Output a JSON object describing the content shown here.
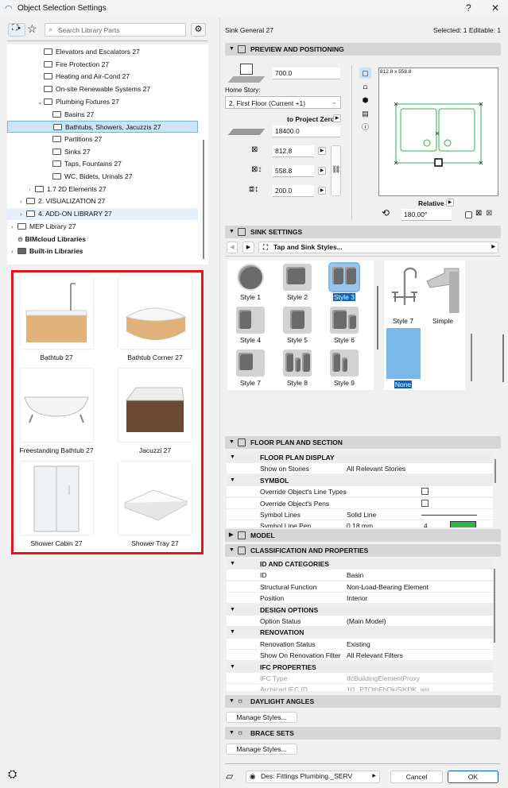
{
  "window": {
    "title": "Object Selection Settings",
    "help": "?",
    "close": "✕"
  },
  "library": {
    "search_placeholder": "Search Library Parts",
    "tree": [
      {
        "label": "Elevators and Escalators 27",
        "indent": 3
      },
      {
        "label": "Fire Protection 27",
        "indent": 3
      },
      {
        "label": "Heating and Air-Cond 27",
        "indent": 3
      },
      {
        "label": "On-site Renewable Systems 27",
        "indent": 3
      },
      {
        "label": "Plumbing Fixtures 27",
        "indent": 3,
        "expanded": true
      },
      {
        "label": "Basins 27",
        "indent": 4
      },
      {
        "label": "Bathtubs, Showers, Jacuzzis 27",
        "indent": 4,
        "selected": true
      },
      {
        "label": "Partitions 27",
        "indent": 4
      },
      {
        "label": "Sinks 27",
        "indent": 4
      },
      {
        "label": "Taps, Fountains 27",
        "indent": 4
      },
      {
        "label": "WC, Bidets, Urinals 27",
        "indent": 4
      },
      {
        "label": "1.7 2D Elements 27",
        "indent": 2,
        "collapsed": true
      },
      {
        "label": "2. VISUALIZATION 27",
        "indent": 1,
        "collapsed": true
      },
      {
        "label": "4. ADD-ON LIBRARY 27",
        "indent": 1,
        "collapsed": true,
        "highlight": true
      },
      {
        "label": "MEP Library 27",
        "indent": 0,
        "collapsed": true
      },
      {
        "label": "BIMcloud Libraries",
        "indent": 0,
        "bold": true,
        "cloud": true
      },
      {
        "label": "Built-in Libraries",
        "indent": 0,
        "bold": true,
        "collapsed": true,
        "dark": true
      }
    ],
    "items": [
      {
        "label": "Bathtub 27",
        "kind": "bathtub"
      },
      {
        "label": "Bathtub Corner 27",
        "kind": "corner"
      },
      {
        "label": "Freestanding Bathtub 27",
        "kind": "freestanding"
      },
      {
        "label": "Jacuzzi 27",
        "kind": "jacuzzi"
      },
      {
        "label": "Shower Cabin 27",
        "kind": "cabin"
      },
      {
        "label": "Shower Tray 27",
        "kind": "tray"
      }
    ]
  },
  "right": {
    "object_name": "Sink General 27",
    "selection_info": "Selected: 1 Editable: 1",
    "preview": {
      "title": "PREVIEW AND POSITIONING",
      "elevation": "700.0",
      "home_story_label": "Home Story:",
      "home_story": "2. First Floor (Current +1)",
      "to_project_zero": "to Project Zero",
      "project_zero_value": "18400.0",
      "width": "812.8",
      "depth": "558.8",
      "height": "200.0",
      "dimensions_caption": "812.8 x 558.8",
      "relative_label": "Relative",
      "angle": "180.00°"
    },
    "sink": {
      "title": "SINK SETTINGS",
      "dropdown": "Tap and Sink Styles...",
      "styles": [
        {
          "label": "Style 1"
        },
        {
          "label": "Style 2"
        },
        {
          "label": "Style 3",
          "selected": true
        },
        {
          "label": "Style 4"
        },
        {
          "label": "Style 5"
        },
        {
          "label": "Style 6"
        },
        {
          "label": "Style 7"
        },
        {
          "label": "Style 8"
        },
        {
          "label": "Style 9"
        }
      ],
      "taps": [
        {
          "label": "Style 7"
        },
        {
          "label": "Simple"
        },
        {
          "label": "None",
          "selected": true
        }
      ]
    },
    "floor_plan": {
      "title": "FLOOR PLAN AND SECTION",
      "rows": [
        {
          "label": "FLOOR PLAN DISPLAY",
          "sub": true
        },
        {
          "label": "Show on Stories",
          "value": "All Relevant Stories"
        },
        {
          "label": "SYMBOL",
          "sub": true
        },
        {
          "label": "Override Object's Line Types",
          "value": "",
          "checkbox": true
        },
        {
          "label": "Override Object's Pens",
          "value": "",
          "checkbox": true
        },
        {
          "label": "Symbol Lines",
          "value": "Solid Line"
        },
        {
          "label": "Symbol Line Pen",
          "value": "0.18 mm",
          "extra": "4"
        }
      ]
    },
    "model": {
      "title": "MODEL"
    },
    "classification": {
      "title": "CLASSIFICATION AND PROPERTIES",
      "rows": [
        {
          "label": "ID AND CATEGORIES",
          "sub": true
        },
        {
          "label": "ID",
          "value": "Basin"
        },
        {
          "label": "Structural Function",
          "value": "Non-Load-Bearing Element"
        },
        {
          "label": "Position",
          "value": "Interior"
        },
        {
          "label": "DESIGN OPTIONS",
          "sub": true
        },
        {
          "label": "Option Status",
          "value": "(Main Model)"
        },
        {
          "label": "RENOVATION",
          "sub": true
        },
        {
          "label": "Renovation Status",
          "value": "Existing"
        },
        {
          "label": "Show On Renovation Filter",
          "value": "All Relevant Filters"
        },
        {
          "label": "IFC PROPERTIES",
          "sub": true
        },
        {
          "label": "IFC Type",
          "value": "IfcBuildingElementProxy",
          "dim": true
        },
        {
          "label": "Archicad IFC ID",
          "value": "1l1_PTOthFhOkiSiKDK_wu",
          "dim": true
        }
      ]
    },
    "daylight": {
      "title": "DAYLIGHT ANGLES",
      "button": "Manage Styles..."
    },
    "brace": {
      "title": "BRACE SETS",
      "button": "Manage Styles..."
    },
    "footer": {
      "layer": "Des: Fittings Plumbing._SERV",
      "cancel": "Cancel",
      "ok": "OK"
    }
  },
  "colors": {
    "accent": "#0a64c8",
    "selection": "#cce4f7",
    "highlight_border": "#e8141b",
    "plan_lines": "#2fb34a"
  }
}
